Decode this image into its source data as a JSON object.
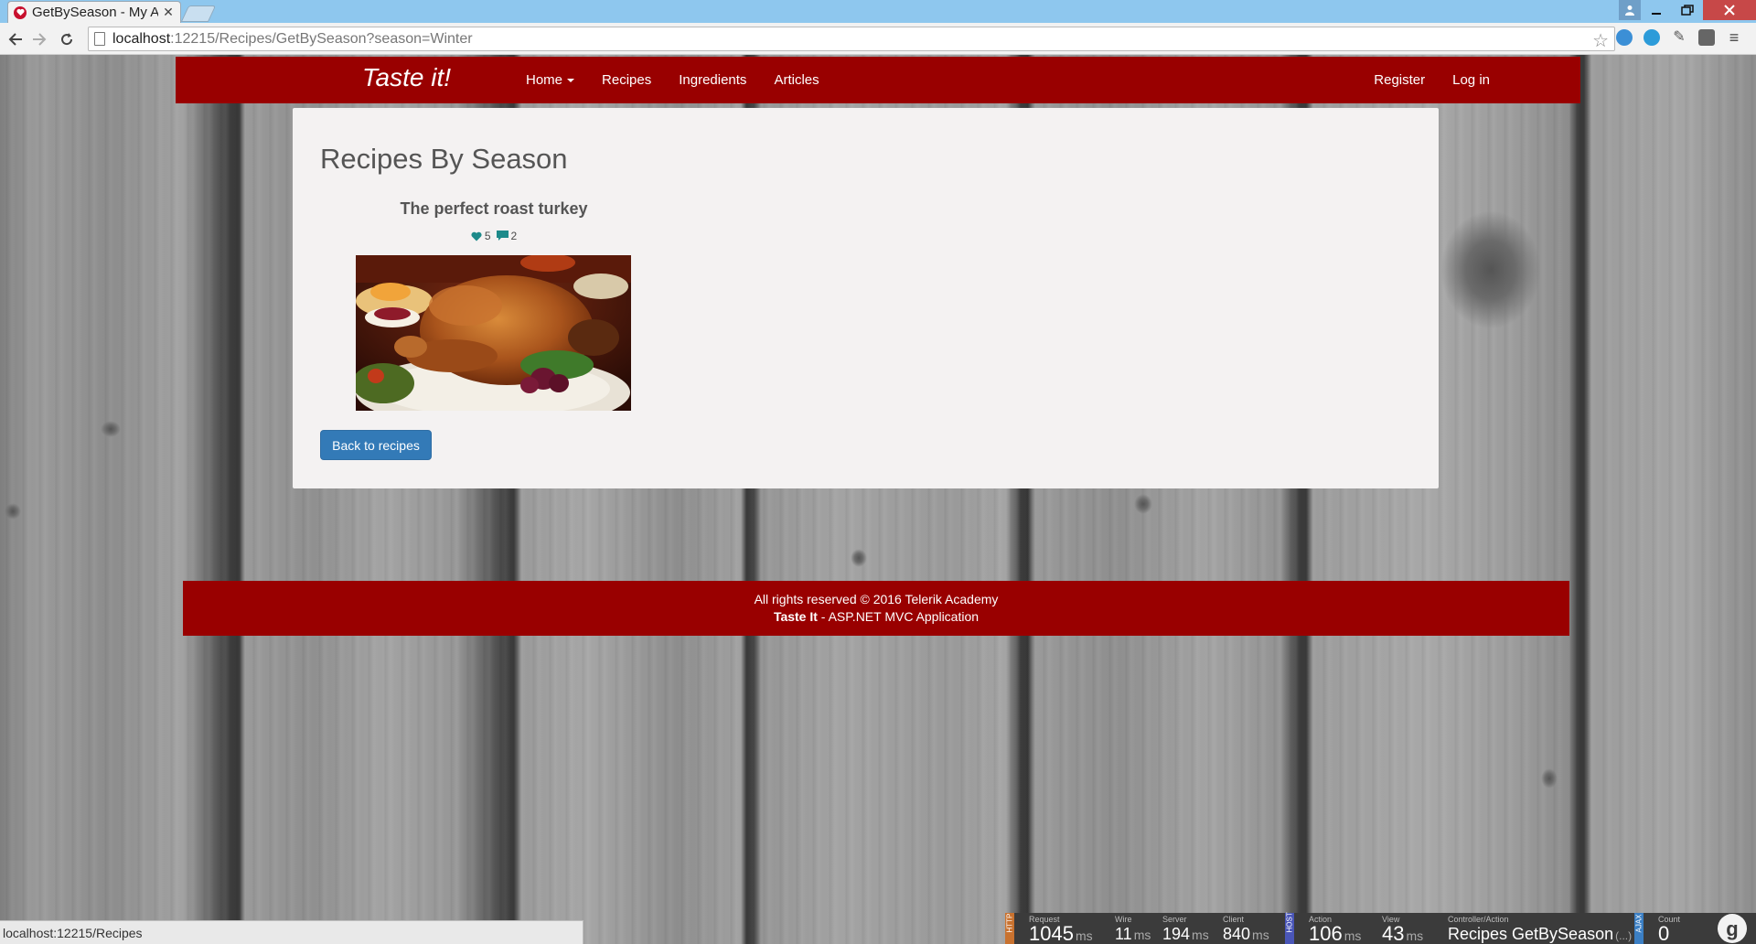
{
  "browser": {
    "tab_title": "GetBySeason - My A",
    "tab_close": "✕",
    "url_host": "localhost",
    "url_path": ":12215/Recipes/GetBySeason?season=Winter",
    "status_url": "localhost:12215/Recipes"
  },
  "navbar": {
    "brand": "Taste it!",
    "home_label": "Home",
    "recipes_label": "Recipes",
    "ingredients_label": "Ingredients",
    "articles_label": "Articles",
    "register_label": "Register",
    "login_label": "Log in"
  },
  "main": {
    "page_title": "Recipes By Season",
    "recipes": [
      {
        "title": "The perfect roast turkey",
        "likes": "5",
        "comments": "2"
      }
    ],
    "back_button": "Back to recipes"
  },
  "footer": {
    "line1": "All rights reserved © 2016 Telerik Academy",
    "brand": "Taste It",
    "line2_rest": " - ASP.NET MVC Application"
  },
  "glimpse": {
    "http_tag": "HTTP",
    "host_tag": "HOST",
    "ajax_tag": "AJAX",
    "request_label": "Request",
    "request_value": "1045",
    "request_unit": "ms",
    "wire_label": "Wire",
    "wire_value": "11",
    "wire_unit": "ms",
    "server_label": "Server",
    "server_value": "194",
    "server_unit": "ms",
    "client_label": "Client",
    "client_value": "840",
    "client_unit": "ms",
    "action_label": "Action",
    "action_value": "106",
    "action_unit": "ms",
    "view_label": "View",
    "view_value": "43",
    "view_unit": "ms",
    "controller_label": "Controller/Action",
    "controller_value": "Recipes GetBySeason",
    "controller_suffix": "(...)",
    "count_label": "Count",
    "count_value": "0"
  },
  "colors": {
    "navbar": "#990000",
    "button": "#337ab7",
    "panel": "#f4f2f2"
  }
}
